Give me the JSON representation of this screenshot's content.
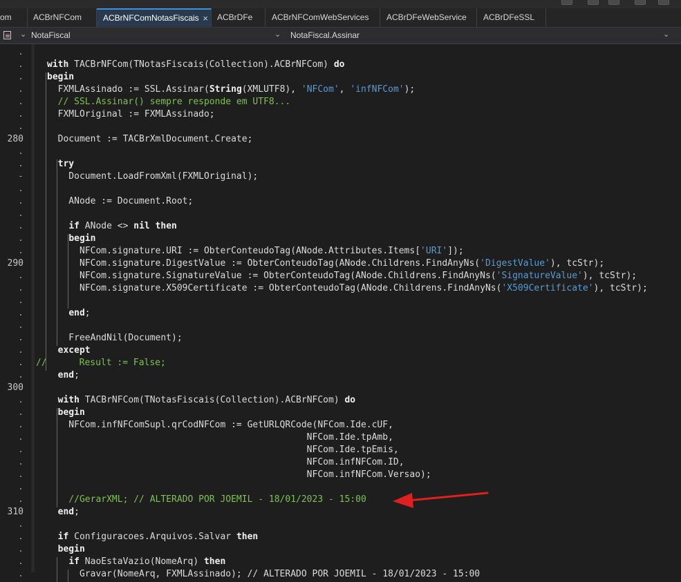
{
  "tabs": [
    {
      "label": "om"
    },
    {
      "label": "ACBrNFCom"
    },
    {
      "label": "ACBrNFComNotasFiscais",
      "active": true
    },
    {
      "label": "ACBrDFe"
    },
    {
      "label": "ACBrNFComWebServices"
    },
    {
      "label": "ACBrDFeWebService"
    },
    {
      "label": "ACBrDFeSSL"
    }
  ],
  "tab_close_glyph": "×",
  "navbar": {
    "unit": "NotaFiscal",
    "method": "NotaFiscal.Assinar",
    "unit_icon": "file-icon"
  },
  "gutter": {
    "markers": [
      ".",
      ".",
      ".",
      ".",
      ".",
      ".",
      ".",
      "280",
      ".",
      ".",
      "-",
      ".",
      ".",
      ".",
      ".",
      ".",
      ".",
      "290",
      ".",
      ".",
      ".",
      ".",
      ".",
      ".",
      ".",
      ".",
      ".",
      "300",
      ".",
      ".",
      ".",
      ".",
      ".",
      ".",
      ".",
      ".",
      ".",
      "310",
      ".",
      ".",
      "."
    ]
  },
  "code_lines": [
    [],
    [
      {
        "t": "with",
        "c": "kw"
      },
      {
        "t": " TACBrNFCom(TNotasFiscais(Collection).ACBrNFCom) "
      },
      {
        "t": "do",
        "c": "kw"
      }
    ],
    [
      {
        "t": "begin",
        "c": "kw"
      }
    ],
    [
      {
        "t": "  FXMLAssinado := SSL.Assinar("
      },
      {
        "t": "String",
        "c": "kw"
      },
      {
        "t": "(XMLUTF8), "
      },
      {
        "t": "'NFCom'",
        "c": "str"
      },
      {
        "t": ", "
      },
      {
        "t": "'infNFCom'",
        "c": "str"
      },
      {
        "t": ");"
      }
    ],
    [
      {
        "t": "  // SSL.Assinar() sempre responde em UTF8...",
        "c": "cmt"
      }
    ],
    [
      {
        "t": "  FXMLOriginal := FXMLAssinado;"
      }
    ],
    [],
    [
      {
        "t": "  Document := TACBrXmlDocument.Create;"
      }
    ],
    [],
    [
      {
        "t": "  "
      },
      {
        "t": "try",
        "c": "kw"
      }
    ],
    [
      {
        "t": "    Document.LoadFromXml(FXMLOriginal);"
      }
    ],
    [],
    [
      {
        "t": "    ANode := Document.Root;"
      }
    ],
    [],
    [
      {
        "t": "    "
      },
      {
        "t": "if",
        "c": "kw"
      },
      {
        "t": " ANode <> "
      },
      {
        "t": "nil",
        "c": "kw"
      },
      {
        "t": " "
      },
      {
        "t": "then",
        "c": "kw"
      }
    ],
    [
      {
        "t": "    "
      },
      {
        "t": "begin",
        "c": "kw"
      }
    ],
    [
      {
        "t": "      NFCom.signature.URI := ObterConteudoTag(ANode.Attributes.Items["
      },
      {
        "t": "'URI'",
        "c": "str"
      },
      {
        "t": "]);"
      }
    ],
    [
      {
        "t": "      NFCom.signature.DigestValue := ObterConteudoTag(ANode.Childrens.FindAnyNs("
      },
      {
        "t": "'DigestValue'",
        "c": "str"
      },
      {
        "t": "), tcStr);"
      }
    ],
    [
      {
        "t": "      NFCom.signature.SignatureValue := ObterConteudoTag(ANode.Childrens.FindAnyNs("
      },
      {
        "t": "'SignatureValue'",
        "c": "str"
      },
      {
        "t": "), tcStr);"
      }
    ],
    [
      {
        "t": "      NFCom.signature.X509Certificate := ObterConteudoTag(ANode.Childrens.FindAnyNs("
      },
      {
        "t": "'X509Certificate'",
        "c": "str"
      },
      {
        "t": "), tcStr);"
      }
    ],
    [],
    [
      {
        "t": "    "
      },
      {
        "t": "end",
        "c": "kw"
      },
      {
        "t": ";"
      }
    ],
    [],
    [
      {
        "t": "    FreeAndNil(Document);"
      }
    ],
    [
      {
        "t": "  "
      },
      {
        "t": "except",
        "c": "kw"
      }
    ],
    [
      {
        "t": "//      Result := False;",
        "c": "cmt"
      }
    ],
    [
      {
        "t": "  "
      },
      {
        "t": "end",
        "c": "kw"
      },
      {
        "t": ";"
      }
    ],
    [],
    [
      {
        "t": "  "
      },
      {
        "t": "with",
        "c": "kw"
      },
      {
        "t": " TACBrNFCom(TNotasFiscais(Collection).ACBrNFCom) "
      },
      {
        "t": "do",
        "c": "kw"
      }
    ],
    [
      {
        "t": "  "
      },
      {
        "t": "begin",
        "c": "kw"
      }
    ],
    [
      {
        "t": "    NFCom.infNFComSupl.qrCodNFCom := GetURLQRCode(NFCom.Ide.cUF,"
      }
    ],
    [
      {
        "t": "                                                NFCom.Ide.tpAmb,"
      }
    ],
    [
      {
        "t": "                                                NFCom.Ide.tpEmis,"
      }
    ],
    [
      {
        "t": "                                                NFCom.infNFCom.ID,"
      }
    ],
    [
      {
        "t": "                                                NFCom.infNFCom.Versao);"
      }
    ],
    [],
    [
      {
        "t": "    //GerarXML; // ALTERADO POR JOEMIL - 18/01/2023 - 15:00",
        "c": "cmt"
      }
    ],
    [
      {
        "t": "  "
      },
      {
        "t": "end",
        "c": "kw"
      },
      {
        "t": ";"
      }
    ],
    [],
    [
      {
        "t": "  "
      },
      {
        "t": "if",
        "c": "kw"
      },
      {
        "t": " Configuracoes.Arquivos.Salvar "
      },
      {
        "t": "then",
        "c": "kw"
      }
    ],
    [
      {
        "t": "  "
      },
      {
        "t": "begin",
        "c": "kw"
      }
    ],
    [
      {
        "t": "    "
      },
      {
        "t": "if",
        "c": "kw"
      },
      {
        "t": " NaoEstaVazio(NomeArq) "
      },
      {
        "t": "then",
        "c": "kw"
      }
    ],
    [
      {
        "t": "      Gravar(NomeArq, FXMLAssinado); // ALTERADO POR JOEMIL - 18/01/2023 - 15:00"
      }
    ]
  ],
  "colors": {
    "background": "#1e1e1e",
    "keyword": "#f0f0f0",
    "string": "#569cd6",
    "comment": "#7ec252",
    "active_tab_border": "#3d8fdc",
    "annotation_arrow": "#e02020"
  },
  "annotation_arrow_icon": "red-arrow-icon"
}
